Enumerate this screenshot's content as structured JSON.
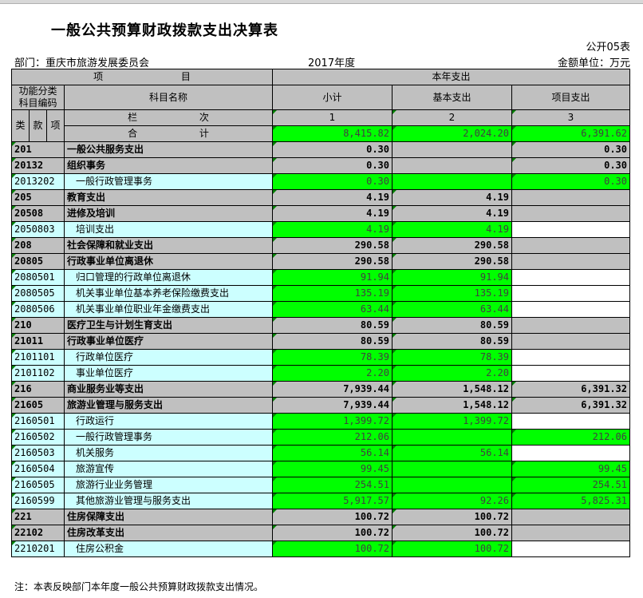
{
  "title": "一般公共预算财政拨款支出决算表",
  "form_no": "公开05表",
  "department": "部门：重庆市旅游发展委员会",
  "year": "2017年度",
  "unit": "金额单位：万元",
  "header": {
    "item_a": "项",
    "item_b": "目",
    "year_spend": "本年支出",
    "func_code": "功能分类科目编码",
    "subject_name": "科目名称",
    "subtotal": "小计",
    "basic": "基本支出",
    "project": "项目支出",
    "col_a": "栏",
    "col_b": "次",
    "lei": "类",
    "kuan": "款",
    "xiang": "项",
    "col1": "1",
    "col2": "2",
    "col3": "3",
    "total_a": "合",
    "total_b": "计",
    "total_subtotal": "8,415.82",
    "total_basic": "2,024.20",
    "total_project": "6,391.62"
  },
  "rows": [
    {
      "level": 1,
      "code": "201",
      "name": "一般公共服务支出",
      "subtotal": "0.30",
      "basic": "",
      "project": "0.30"
    },
    {
      "level": 2,
      "code": "20132",
      "name": "组织事务",
      "subtotal": "0.30",
      "basic": "",
      "project": "0.30"
    },
    {
      "level": 3,
      "code": "2013202",
      "name": "一般行政管理事务",
      "subtotal": "0.30",
      "basic": "",
      "project": "0.30"
    },
    {
      "level": 1,
      "code": "205",
      "name": "教育支出",
      "subtotal": "4.19",
      "basic": "4.19",
      "project": ""
    },
    {
      "level": 2,
      "code": "20508",
      "name": "进修及培训",
      "subtotal": "4.19",
      "basic": "4.19",
      "project": ""
    },
    {
      "level": 3,
      "code": "2050803",
      "name": "培训支出",
      "subtotal": "4.19",
      "basic": "4.19",
      "project": ""
    },
    {
      "level": 1,
      "code": "208",
      "name": "社会保障和就业支出",
      "subtotal": "290.58",
      "basic": "290.58",
      "project": ""
    },
    {
      "level": 2,
      "code": "20805",
      "name": "行政事业单位离退休",
      "subtotal": "290.58",
      "basic": "290.58",
      "project": ""
    },
    {
      "level": 3,
      "code": "2080501",
      "name": "归口管理的行政单位离退休",
      "subtotal": "91.94",
      "basic": "91.94",
      "project": ""
    },
    {
      "level": 3,
      "code": "2080505",
      "name": "机关事业单位基本养老保险缴费支出",
      "subtotal": "135.19",
      "basic": "135.19",
      "project": ""
    },
    {
      "level": 3,
      "code": "2080506",
      "name": "机关事业单位职业年金缴费支出",
      "subtotal": "63.44",
      "basic": "63.44",
      "project": ""
    },
    {
      "level": 1,
      "code": "210",
      "name": "医疗卫生与计划生育支出",
      "subtotal": "80.59",
      "basic": "80.59",
      "project": ""
    },
    {
      "level": 2,
      "code": "21011",
      "name": "行政事业单位医疗",
      "subtotal": "80.59",
      "basic": "80.59",
      "project": ""
    },
    {
      "level": 3,
      "code": "2101101",
      "name": "行政单位医疗",
      "subtotal": "78.39",
      "basic": "78.39",
      "project": ""
    },
    {
      "level": 3,
      "code": "2101102",
      "name": "事业单位医疗",
      "subtotal": "2.20",
      "basic": "2.20",
      "project": ""
    },
    {
      "level": 1,
      "code": "216",
      "name": "商业服务业等支出",
      "subtotal": "7,939.44",
      "basic": "1,548.12",
      "project": "6,391.32"
    },
    {
      "level": 2,
      "code": "21605",
      "name": "旅游业管理与服务支出",
      "subtotal": "7,939.44",
      "basic": "1,548.12",
      "project": "6,391.32"
    },
    {
      "level": 3,
      "code": "2160501",
      "name": "行政运行",
      "subtotal": "1,399.72",
      "basic": "1,399.72",
      "project": ""
    },
    {
      "level": 3,
      "code": "2160502",
      "name": "一般行政管理事务",
      "subtotal": "212.06",
      "basic": "",
      "project": "212.06"
    },
    {
      "level": 3,
      "code": "2160503",
      "name": "机关服务",
      "subtotal": "56.14",
      "basic": "56.14",
      "project": ""
    },
    {
      "level": 3,
      "code": "2160504",
      "name": "旅游宣传",
      "subtotal": "99.45",
      "basic": "",
      "project": "99.45"
    },
    {
      "level": 3,
      "code": "2160505",
      "name": "旅游行业业务管理",
      "subtotal": "254.51",
      "basic": "",
      "project": "254.51"
    },
    {
      "level": 3,
      "code": "2160599",
      "name": "其他旅游业管理与服务支出",
      "subtotal": "5,917.57",
      "basic": "92.26",
      "project": "5,825.31"
    },
    {
      "level": 1,
      "code": "221",
      "name": "住房保障支出",
      "subtotal": "100.72",
      "basic": "100.72",
      "project": ""
    },
    {
      "level": 2,
      "code": "22102",
      "name": "住房改革支出",
      "subtotal": "100.72",
      "basic": "100.72",
      "project": ""
    },
    {
      "level": 3,
      "code": "2210201",
      "name": "住房公积金",
      "subtotal": "100.72",
      "basic": "100.72",
      "project": ""
    }
  ],
  "note": "注：本表反映部门本年度一般公共预算财政拨款支出情况。"
}
